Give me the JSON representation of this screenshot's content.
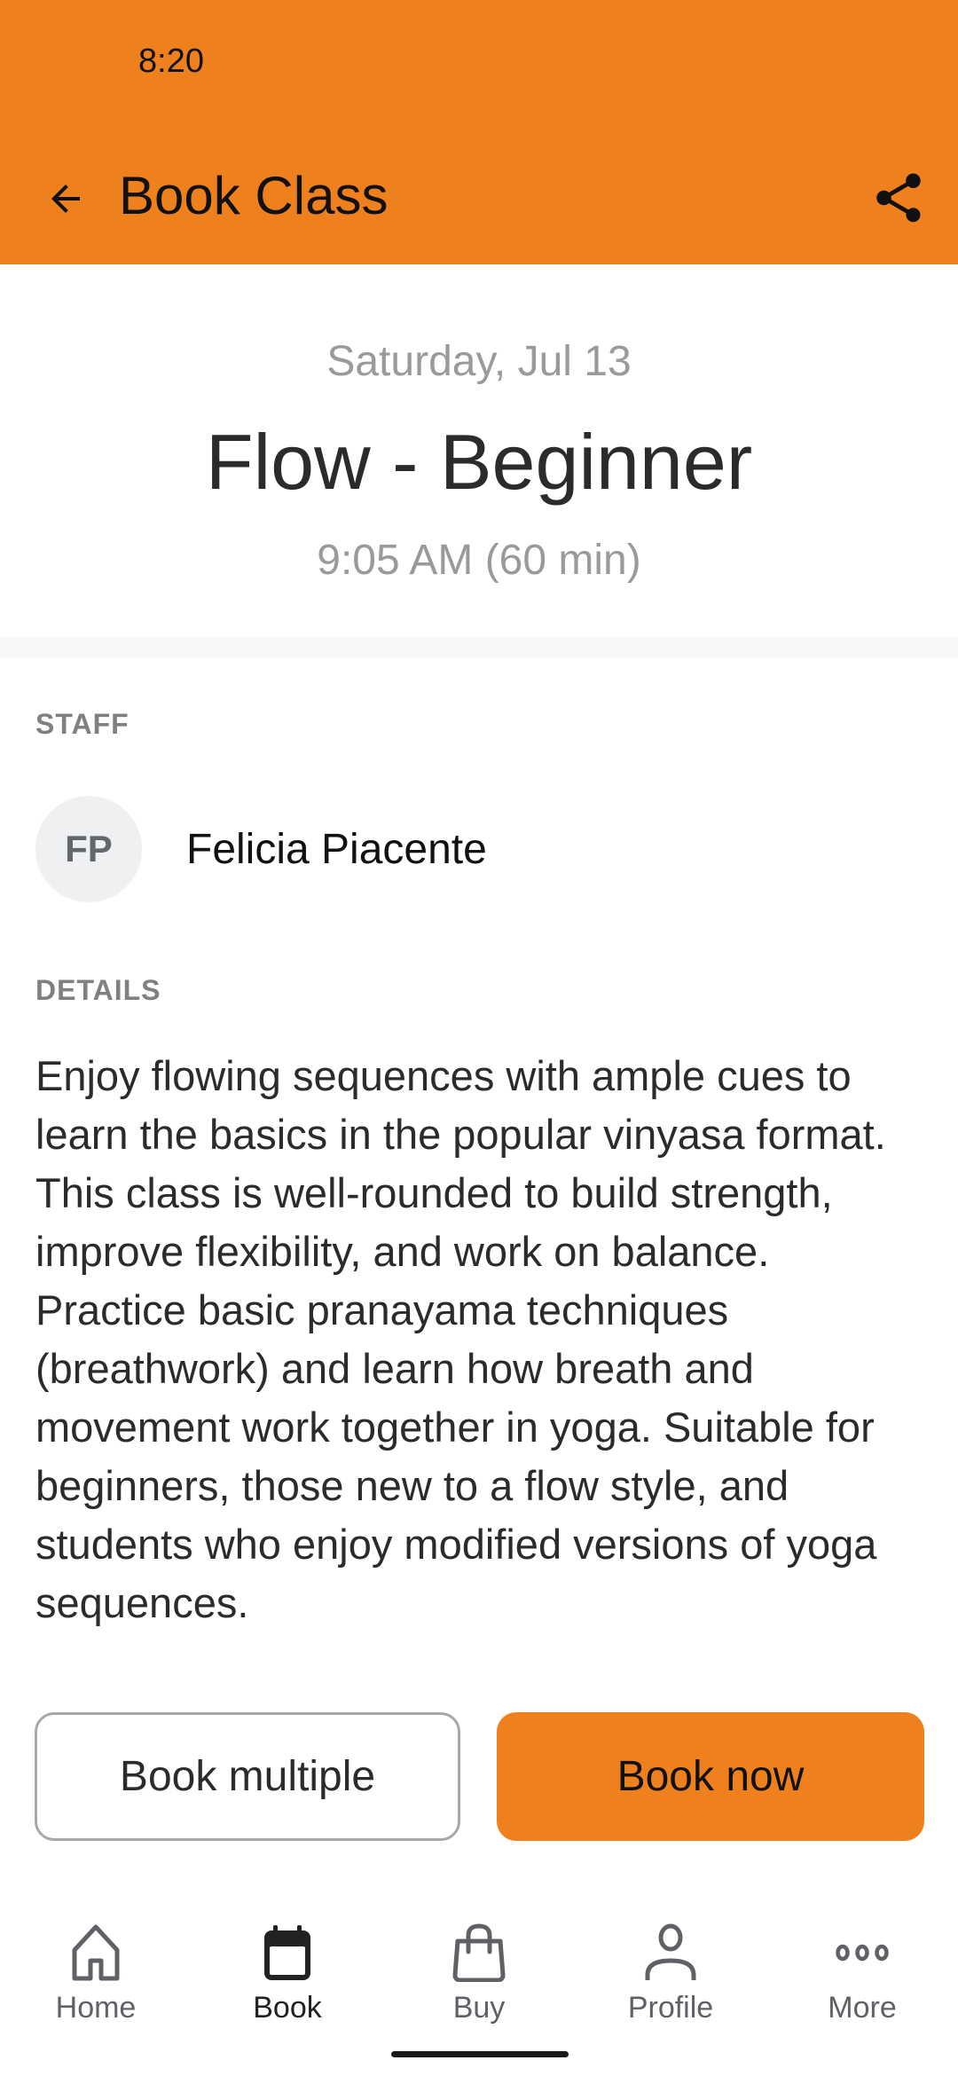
{
  "status_bar": {
    "time": "8:20"
  },
  "app_bar": {
    "title": "Book Class",
    "back_icon": "arrow-left-icon",
    "share_icon": "share-icon",
    "background_color": "#ee801e"
  },
  "class": {
    "date": "Saturday, Jul 13",
    "title": "Flow - Beginner",
    "time": "9:05 AM (60 min)"
  },
  "staff": {
    "label": "STAFF",
    "initials": "FP",
    "name": "Felicia Piacente"
  },
  "details": {
    "label": "DETAILS",
    "text": "Enjoy flowing sequences with ample cues to learn the basics in the popular vinyasa format. This class is well-rounded to build strength, improve flexibility, and work on balance. Practice basic pranayama techniques (breathwork) and learn how breath and movement work together in yoga. Suitable for beginners, those new to a flow style, and students who enjoy modified versions of yoga sequences."
  },
  "actions": {
    "book_multiple": "Book multiple",
    "book_now": "Book now"
  },
  "bottom_nav": {
    "active": "Book",
    "items": [
      {
        "label": "Home",
        "icon": "home-icon"
      },
      {
        "label": "Book",
        "icon": "calendar-icon"
      },
      {
        "label": "Buy",
        "icon": "shopping-bag-icon"
      },
      {
        "label": "Profile",
        "icon": "person-icon"
      },
      {
        "label": "More",
        "icon": "more-dots-icon"
      }
    ]
  }
}
